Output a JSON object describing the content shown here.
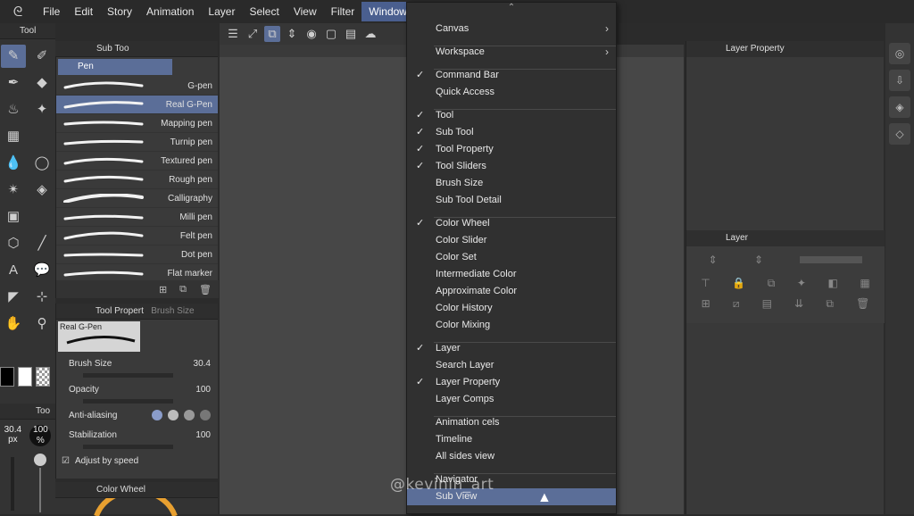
{
  "menubar": {
    "items": [
      "File",
      "Edit",
      "Story",
      "Animation",
      "Layer",
      "Select",
      "View",
      "Filter",
      "Window"
    ]
  },
  "panels": {
    "tool_tab": "Tool",
    "subtool_tab": "Sub Too",
    "pen_group": "Pen",
    "tool_property_tab": "Tool Propert",
    "brush_size_tab": "Brush Size",
    "color_wheel_tab": "Color Wheel",
    "layer_property_tab": "Layer Property",
    "layer_tab": "Layer",
    "tool_tab2": "Too"
  },
  "brushes": [
    {
      "name": "G-pen"
    },
    {
      "name": "Real G-Pen"
    },
    {
      "name": "Mapping pen"
    },
    {
      "name": "Turnip pen"
    },
    {
      "name": "Textured pen"
    },
    {
      "name": "Rough pen"
    },
    {
      "name": "Calligraphy"
    },
    {
      "name": "Milli pen"
    },
    {
      "name": "Felt pen"
    },
    {
      "name": "Dot pen"
    },
    {
      "name": "Flat marker"
    }
  ],
  "tool_property": {
    "preview_label": "Real G-Pen",
    "brush_size_label": "Brush Size",
    "brush_size_value": "30.4",
    "opacity_label": "Opacity",
    "opacity_value": "100",
    "anti_aliasing_label": "Anti-aliasing",
    "stabilization_label": "Stabilization",
    "stabilization_value": "100",
    "adjust_label": "Adjust by speed"
  },
  "slider_panel": {
    "size_value": "30.4",
    "size_unit": "px",
    "opacity_value": "100",
    "opacity_unit": "%"
  },
  "window_menu": {
    "items": [
      {
        "label": "Canvas",
        "checked": false,
        "submenu": true
      },
      {
        "label": "Workspace",
        "checked": false,
        "submenu": true
      },
      {
        "label": "Command Bar",
        "checked": true
      },
      {
        "label": "Quick Access",
        "checked": false
      },
      {
        "label": "Tool",
        "checked": true
      },
      {
        "label": "Sub Tool",
        "checked": true
      },
      {
        "label": "Tool Property",
        "checked": true
      },
      {
        "label": "Tool Sliders",
        "checked": true
      },
      {
        "label": "Brush Size",
        "checked": false
      },
      {
        "label": "Sub Tool Detail",
        "checked": false
      },
      {
        "label": "Color Wheel",
        "checked": true
      },
      {
        "label": "Color Slider",
        "checked": false
      },
      {
        "label": "Color Set",
        "checked": false
      },
      {
        "label": "Intermediate Color",
        "checked": false
      },
      {
        "label": "Approximate Color",
        "checked": false
      },
      {
        "label": "Color History",
        "checked": false
      },
      {
        "label": "Color Mixing",
        "checked": false
      },
      {
        "label": "Layer",
        "checked": true
      },
      {
        "label": "Search Layer",
        "checked": false
      },
      {
        "label": "Layer Property",
        "checked": true
      },
      {
        "label": "Layer Comps",
        "checked": false
      },
      {
        "label": "Animation cels",
        "checked": false
      },
      {
        "label": "Timeline",
        "checked": false
      },
      {
        "label": "All sides view",
        "checked": false
      },
      {
        "label": "Navigator",
        "checked": false
      },
      {
        "label": "Sub View",
        "checked": false,
        "highlighted": true
      }
    ],
    "check_glyph": "✓"
  },
  "watermark": "@kevinin_art"
}
